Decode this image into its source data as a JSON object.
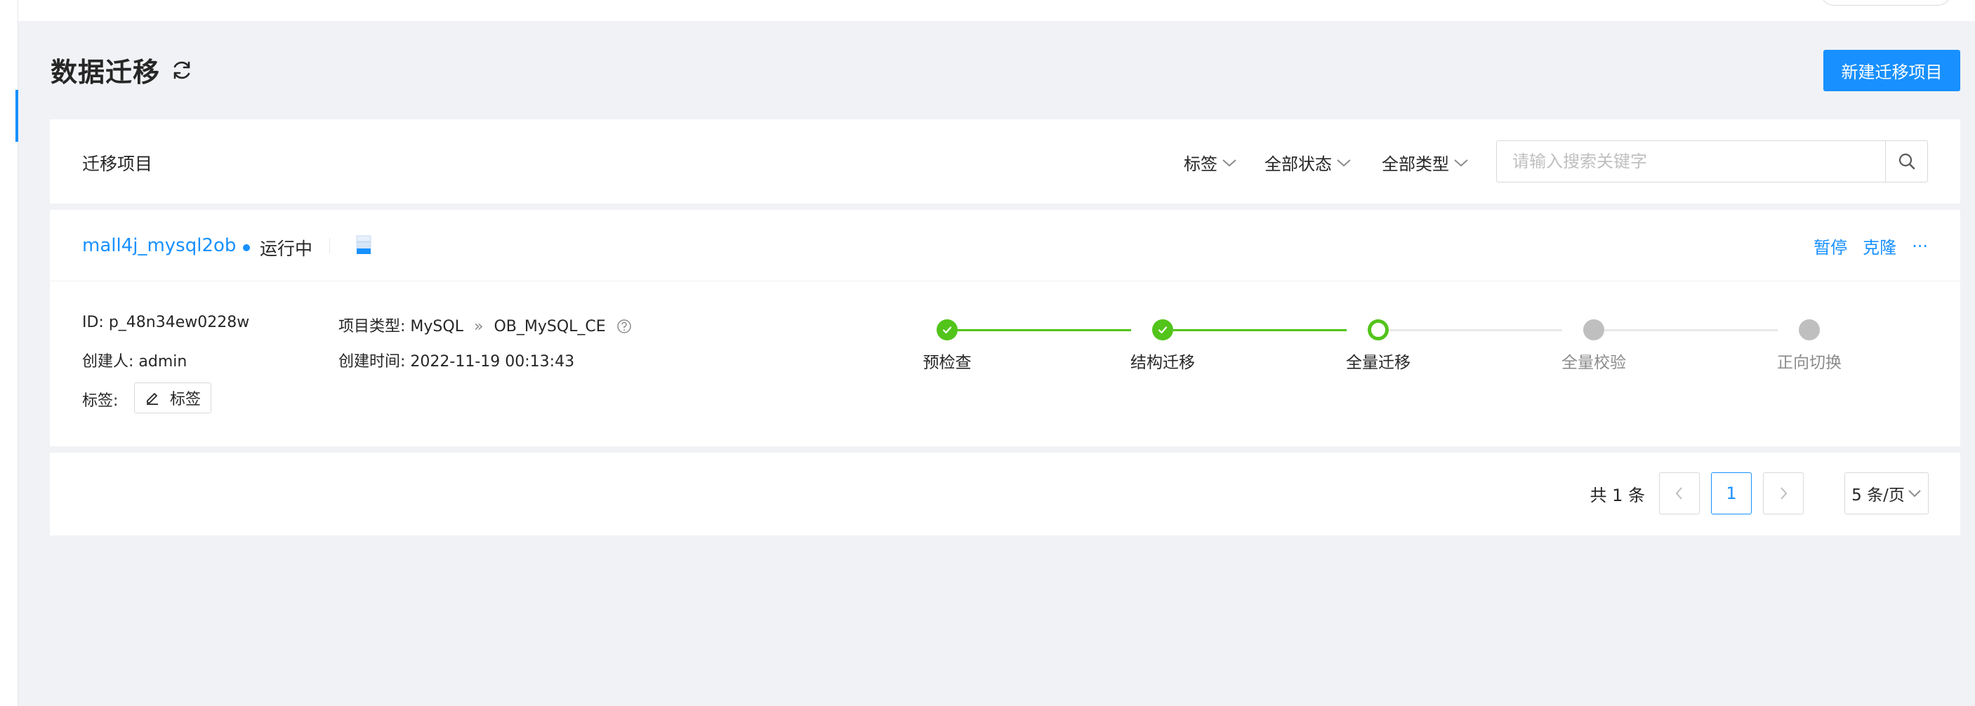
{
  "page": {
    "title": "数据迁移",
    "new_button": "新建迁移项目"
  },
  "filter_bar": {
    "section_title": "迁移项目",
    "tag_filter": "标签",
    "status_filter": "全部状态",
    "type_filter": "全部类型",
    "search_placeholder": "请输入搜索关键字"
  },
  "project": {
    "name": "mall4j_mysql2ob",
    "status": "运行中",
    "actions": {
      "pause": "暂停",
      "clone": "克隆",
      "more": "···"
    },
    "id_label": "ID:",
    "id_value": "p_48n34ew0228w",
    "creator_label": "创建人:",
    "creator_value": "admin",
    "tags_label": "标签:",
    "tag_button": "标签",
    "type_label": "项目类型:",
    "source_type": "MySQL",
    "type_separator": "»",
    "target_type": "OB_MySQL_CE",
    "created_label": "创建时间:",
    "created_value": "2022-11-19 00:13:43",
    "steps": [
      {
        "label": "预检查",
        "state": "done"
      },
      {
        "label": "结构迁移",
        "state": "done"
      },
      {
        "label": "全量迁移",
        "state": "current"
      },
      {
        "label": "全量校验",
        "state": "wait"
      },
      {
        "label": "正向切换",
        "state": "wait"
      }
    ]
  },
  "pagination": {
    "total": "共 1 条",
    "current_page": "1",
    "page_size": "5 条/页"
  },
  "colors": {
    "primary": "#1890ff",
    "success": "#52c41a",
    "wait": "#bfbfbf"
  }
}
